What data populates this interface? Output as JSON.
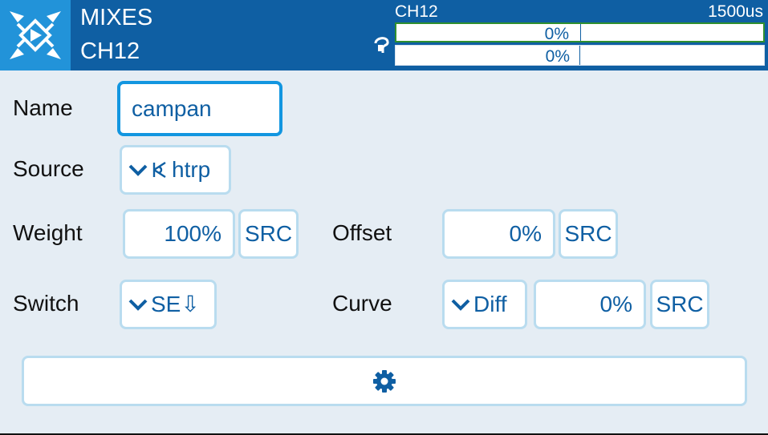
{
  "header": {
    "title": "MIXES",
    "subtitle": "CH12",
    "channel": {
      "name": "CH12",
      "pulse": "1500us",
      "bars": [
        {
          "value": "0%"
        },
        {
          "value": "0%"
        }
      ]
    }
  },
  "form": {
    "name": {
      "label": "Name",
      "value": "campan"
    },
    "source": {
      "label": "Source",
      "value": "htrp",
      "icon": "stick-source-icon"
    },
    "weight": {
      "label": "Weight",
      "value": "100%",
      "src": "SRC"
    },
    "offset": {
      "label": "Offset",
      "value": "0%",
      "src": "SRC"
    },
    "switch": {
      "label": "Switch",
      "value": "SE⇩"
    },
    "curve": {
      "label": "Curve",
      "type": "Diff",
      "value": "0%",
      "src": "SRC"
    }
  },
  "colors": {
    "header": "#0f5fa3",
    "background": "#e5edf4",
    "field_border": "#b9dcef",
    "focus_border": "#1296e0",
    "text_accent": "#0f5fa3"
  }
}
